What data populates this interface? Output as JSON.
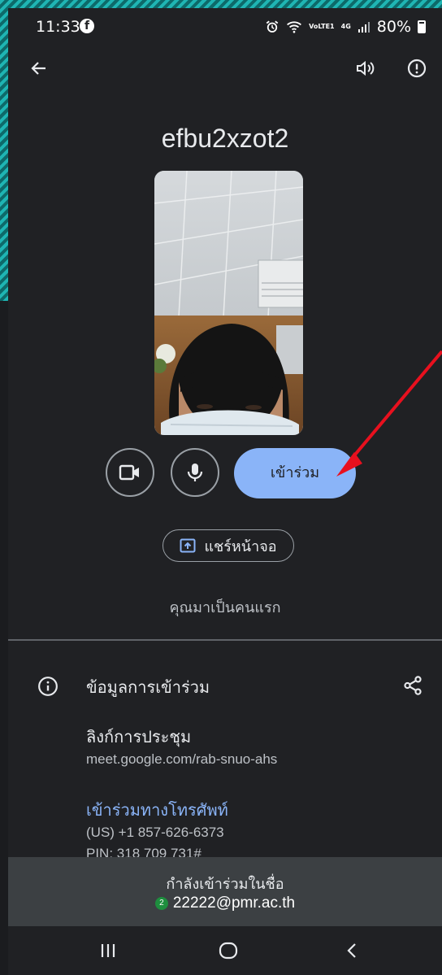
{
  "status": {
    "time": "11:33",
    "battery": "80%",
    "network": "4G",
    "volte": "VoLTE1"
  },
  "meeting": {
    "code": "efbu2xzot2",
    "join_label": "เข้าร่วม",
    "share_label": "แชร์หน้าจอ",
    "first_note": "คุณมาเป็นคนแรก"
  },
  "join_info": {
    "title": "ข้อมูลการเข้าร่วม",
    "link_title": "ลิงก์การประชุม",
    "link_url": "meet.google.com/rab-snuo-ahs",
    "phone_title": "เข้าร่วมทางโทรศัพท์",
    "phone_number": "(US) +1 857-626-6373",
    "pin": "PIN: 318 709 731#"
  },
  "joining": {
    "label": "กำลังเข้าร่วมในชื่อ",
    "account": "22222@pmr.ac.th",
    "badge": "2"
  },
  "colors": {
    "background": "#202124",
    "accent": "#8ab4f8",
    "panel": "#3c4043",
    "annotation": "#e8101e",
    "frame": "#1fb5b3"
  }
}
